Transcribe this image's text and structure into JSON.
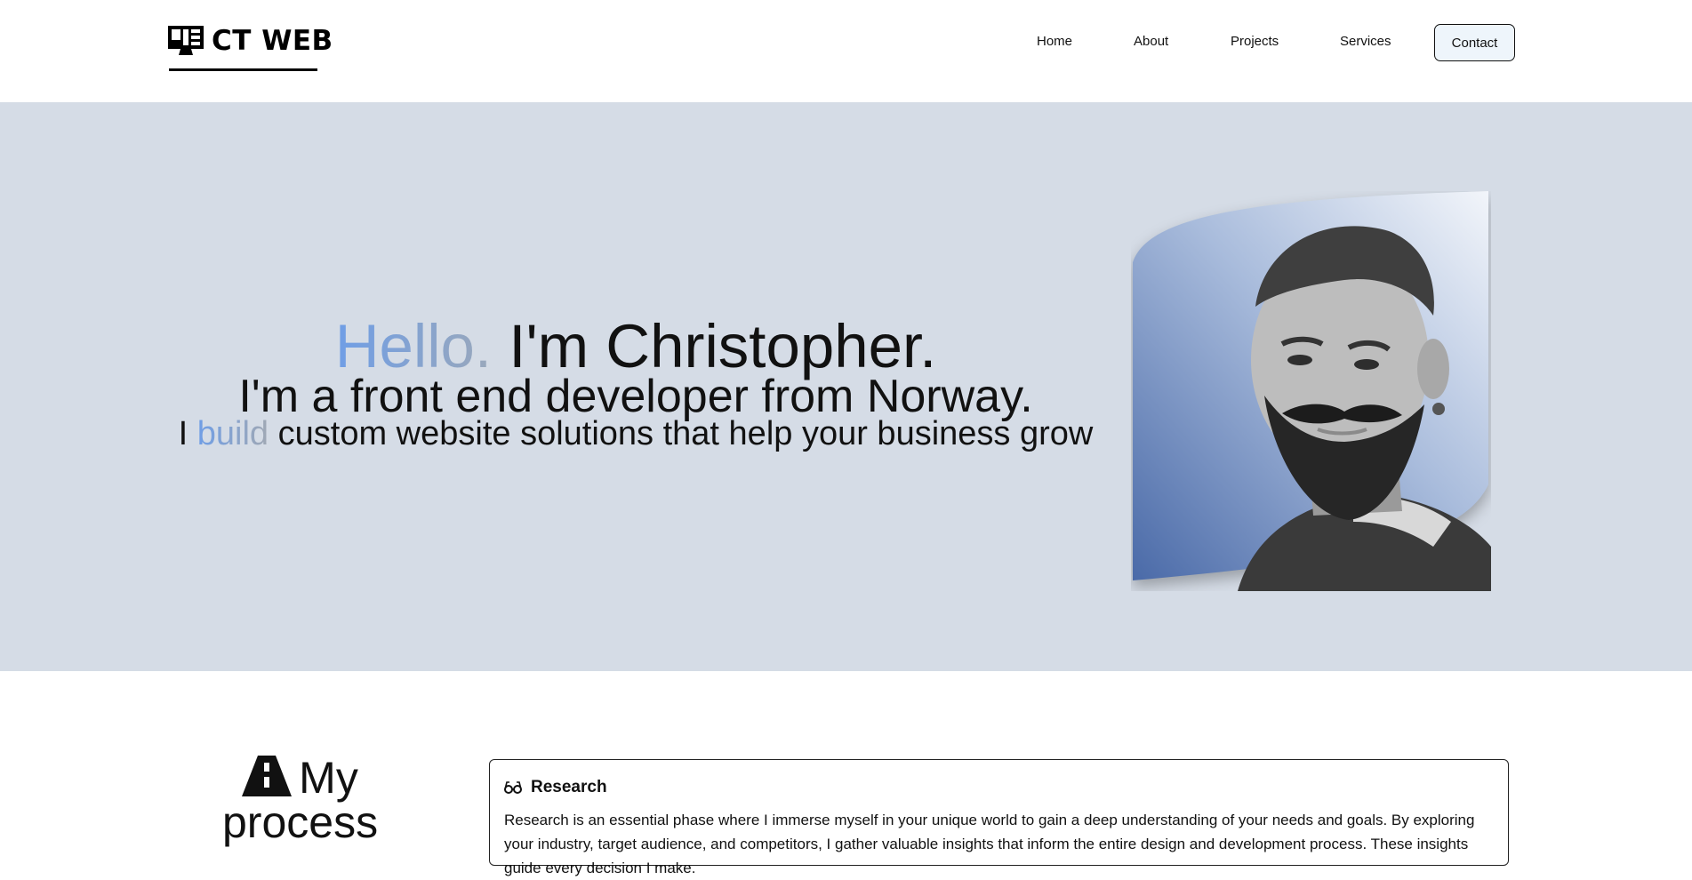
{
  "header": {
    "logo_text": "CT WEB",
    "nav": {
      "home": "Home",
      "about": "About",
      "projects": "Projects",
      "services": "Services",
      "contact": "Contact"
    }
  },
  "hero": {
    "hello": "Hello.",
    "intro": " I'm Christopher.",
    "role": "I'm a front end developer from Norway.",
    "tagline_prefix": "I ",
    "tagline_highlight": "build",
    "tagline_rest": " custom website solutions that help your business grow"
  },
  "process": {
    "title_line1": "My",
    "title_line2": "process",
    "card": {
      "title": "Research",
      "body": "Research is an essential phase where I immerse myself in your unique world to gain a deep understanding of your needs and goals. By exploring your industry, target audience, and competitors, I gather valuable insights that inform the entire design and development process. These insights guide every decision I make."
    }
  },
  "colors": {
    "hero_bg": "#d5dce6",
    "accent_blue": "#6f9ee6",
    "contact_bg": "#eef5fb"
  }
}
